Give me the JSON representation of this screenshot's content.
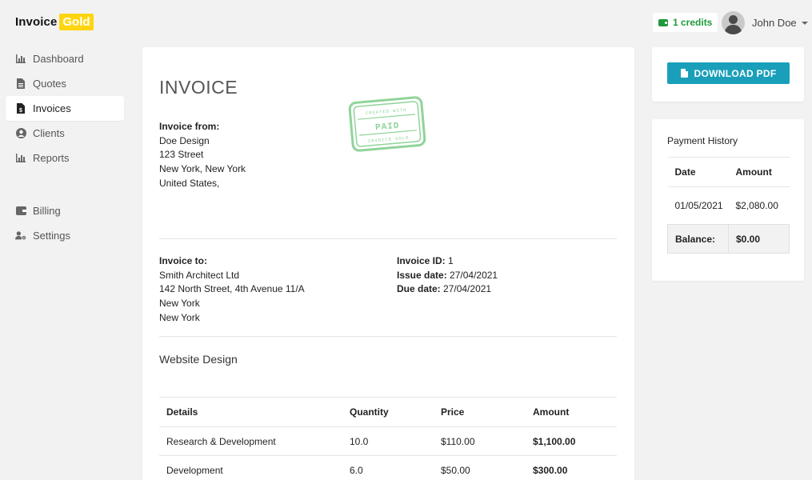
{
  "brand": {
    "word": "Invoice",
    "badge": "Gold"
  },
  "topbar": {
    "credits": "1 credits",
    "user_name": "John Doe"
  },
  "sidebar": {
    "items": [
      {
        "label": "Dashboard",
        "icon": "chart-bar-icon"
      },
      {
        "label": "Quotes",
        "icon": "document-icon"
      },
      {
        "label": "Invoices",
        "icon": "invoice-dollar-icon",
        "active": true
      },
      {
        "label": "Clients",
        "icon": "user-circle-icon"
      },
      {
        "label": "Reports",
        "icon": "chart-bar-icon"
      },
      {
        "label": "Billing",
        "icon": "wallet-icon"
      },
      {
        "label": "Settings",
        "icon": "user-cog-icon"
      }
    ]
  },
  "invoice": {
    "title": "INVOICE",
    "from_label": "Invoice from:",
    "from": [
      "Doe Design",
      "123 Street",
      "New York, New York",
      "United States,"
    ],
    "stamp": {
      "top": "CREATED WITH",
      "main": "PAID",
      "bottom": "INVOICE GOLD"
    },
    "to_label": "Invoice to:",
    "to": [
      "Smith Architect Ltd",
      "142 North Street, 4th Avenue 11/A",
      "New York",
      "New York"
    ],
    "id_label": "Invoice ID:",
    "id_value": "1",
    "issue_label": "Issue date:",
    "issue_value": "27/04/2021",
    "due_label": "Due date:",
    "due_value": "27/04/2021",
    "project": "Website Design",
    "columns": [
      "Details",
      "Quantity",
      "Price",
      "Amount"
    ],
    "rows": [
      [
        "Research & Development",
        "10.0",
        "$110.00",
        "$1,100.00"
      ],
      [
        "Development",
        "6.0",
        "$50.00",
        "$300.00"
      ]
    ]
  },
  "actions": {
    "download_label": "DOWNLOAD PDF"
  },
  "payment_history": {
    "title": "Payment History",
    "columns": [
      "Date",
      "Amount"
    ],
    "rows": [
      [
        "01/05/2021",
        "$2,080.00"
      ]
    ],
    "balance_label": "Balance:",
    "balance_value": "$0.00"
  },
  "colors": {
    "brand_gold": "#ffd510",
    "accent": "#1a9fba",
    "credits_green": "#1e9a3c",
    "stamp_green": "#8fd49a"
  }
}
